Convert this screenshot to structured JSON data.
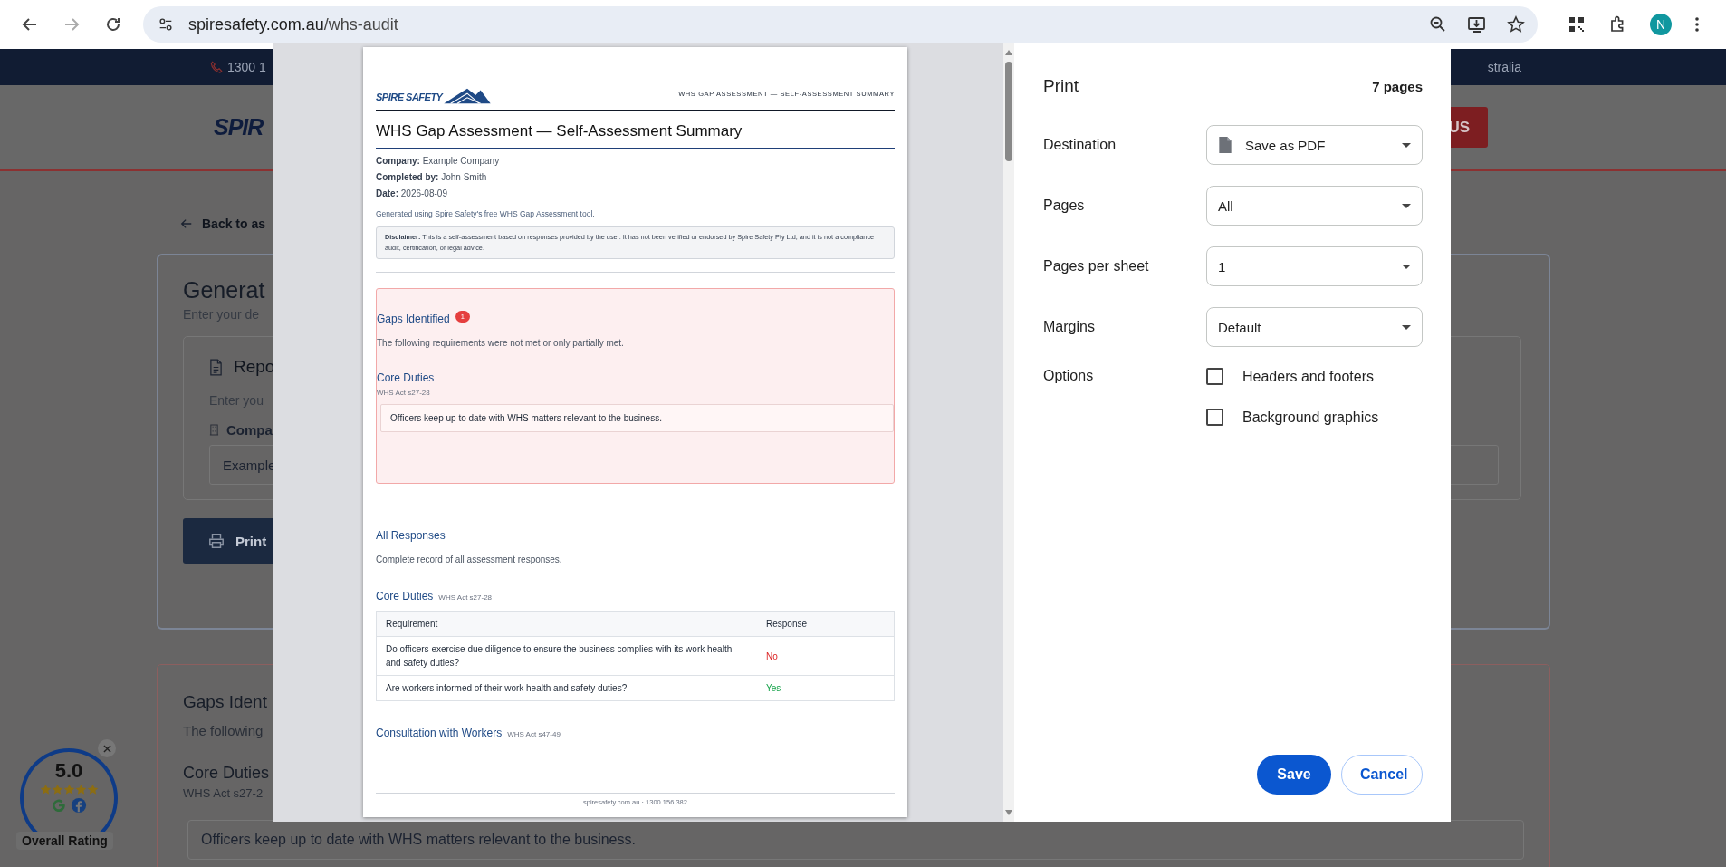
{
  "browser": {
    "url_host": "spiresafety.com.au",
    "url_path": "/whs-audit",
    "profile_initial": "N"
  },
  "page": {
    "top_bar": {
      "phone": "1300 1",
      "right_text": "stralia"
    },
    "header": {
      "logo": "SPIR",
      "button": "US"
    },
    "back_link": "Back to as",
    "generate_card": {
      "title": "Generat",
      "subtitle": "Enter your de",
      "report_title": "Repo",
      "report_hint": "Enter you",
      "company_label": "Compa",
      "company_value": "Example",
      "print_button": "Print"
    },
    "gaps_card": {
      "title": "Gaps Ident",
      "intro": "The following",
      "section_title": "Core Duties",
      "section_ref": "WHS Act s27-2",
      "item": "Officers keep up to date with WHS matters relevant to the business."
    },
    "rating_widget": {
      "score": "5.0",
      "stars": 5,
      "label": "Overall Rating"
    }
  },
  "print_dialog": {
    "preview": {
      "logo": "SPIRE SAFETY",
      "header_title": "WHS GAP ASSESSMENT — SELF-ASSESSMENT SUMMARY",
      "title": "WHS Gap Assessment — Self-Assessment Summary",
      "meta": [
        {
          "label": "Company:",
          "value": "Example Company"
        },
        {
          "label": "Completed by:",
          "value": "John Smith"
        },
        {
          "label": "Date:",
          "value": "2026-08-09"
        }
      ],
      "note": "Generated using Spire Safety's free WHS Gap Assessment tool.",
      "disclaimer": "**Disclaimer:** This is a self-assessment based on responses provided by the user. It has not been verified or endorsed by Spire Safety Pty Ltd, and it is not a compliance audit, certification, or legal advice.",
      "gaps": {
        "title": "Gaps Identified",
        "count": "1",
        "intro": "The following requirements were not met or only partially met.",
        "sections": [
          {
            "title": "Core Duties",
            "ref": "WHS Act s27-28",
            "items": [
              "Officers keep up to date with WHS matters relevant to the business."
            ]
          }
        ]
      },
      "responses": {
        "title": "All Responses",
        "intro": "Complete record of all assessment responses.",
        "sections": [
          {
            "title": "Core Duties",
            "ref": "WHS Act s27-28",
            "columns": [
              "Requirement",
              "Response"
            ],
            "rows": [
              {
                "requirement": "Do officers exercise due diligence to ensure the business complies with its work health and safety duties?",
                "response": "No",
                "kind": "negative"
              },
              {
                "requirement": "Are workers informed of their work health and safety duties?",
                "response": "Yes",
                "kind": "positive"
              }
            ]
          },
          {
            "title": "Consultation with Workers",
            "ref": "WHS Act s47-49"
          }
        ]
      },
      "footer": "spiresafety.com.au · 1300 156 382"
    },
    "settings": {
      "title": "Print",
      "page_count": "7 pages",
      "fields": [
        {
          "label": "Destination",
          "value": "Save as PDF",
          "kind": "file-select"
        },
        {
          "label": "Pages",
          "value": "All",
          "kind": "select"
        },
        {
          "label": "Pages per sheet",
          "value": "1",
          "kind": "select"
        },
        {
          "label": "Margins",
          "value": "Default",
          "kind": "select"
        }
      ],
      "options_label": "Options",
      "options": [
        {
          "label": "Headers and footers",
          "checked": false
        },
        {
          "label": "Background graphics",
          "checked": false
        }
      ],
      "buttons": [
        {
          "label": "Save",
          "kind": "primary"
        },
        {
          "label": "Cancel",
          "kind": "secondary"
        }
      ]
    }
  }
}
